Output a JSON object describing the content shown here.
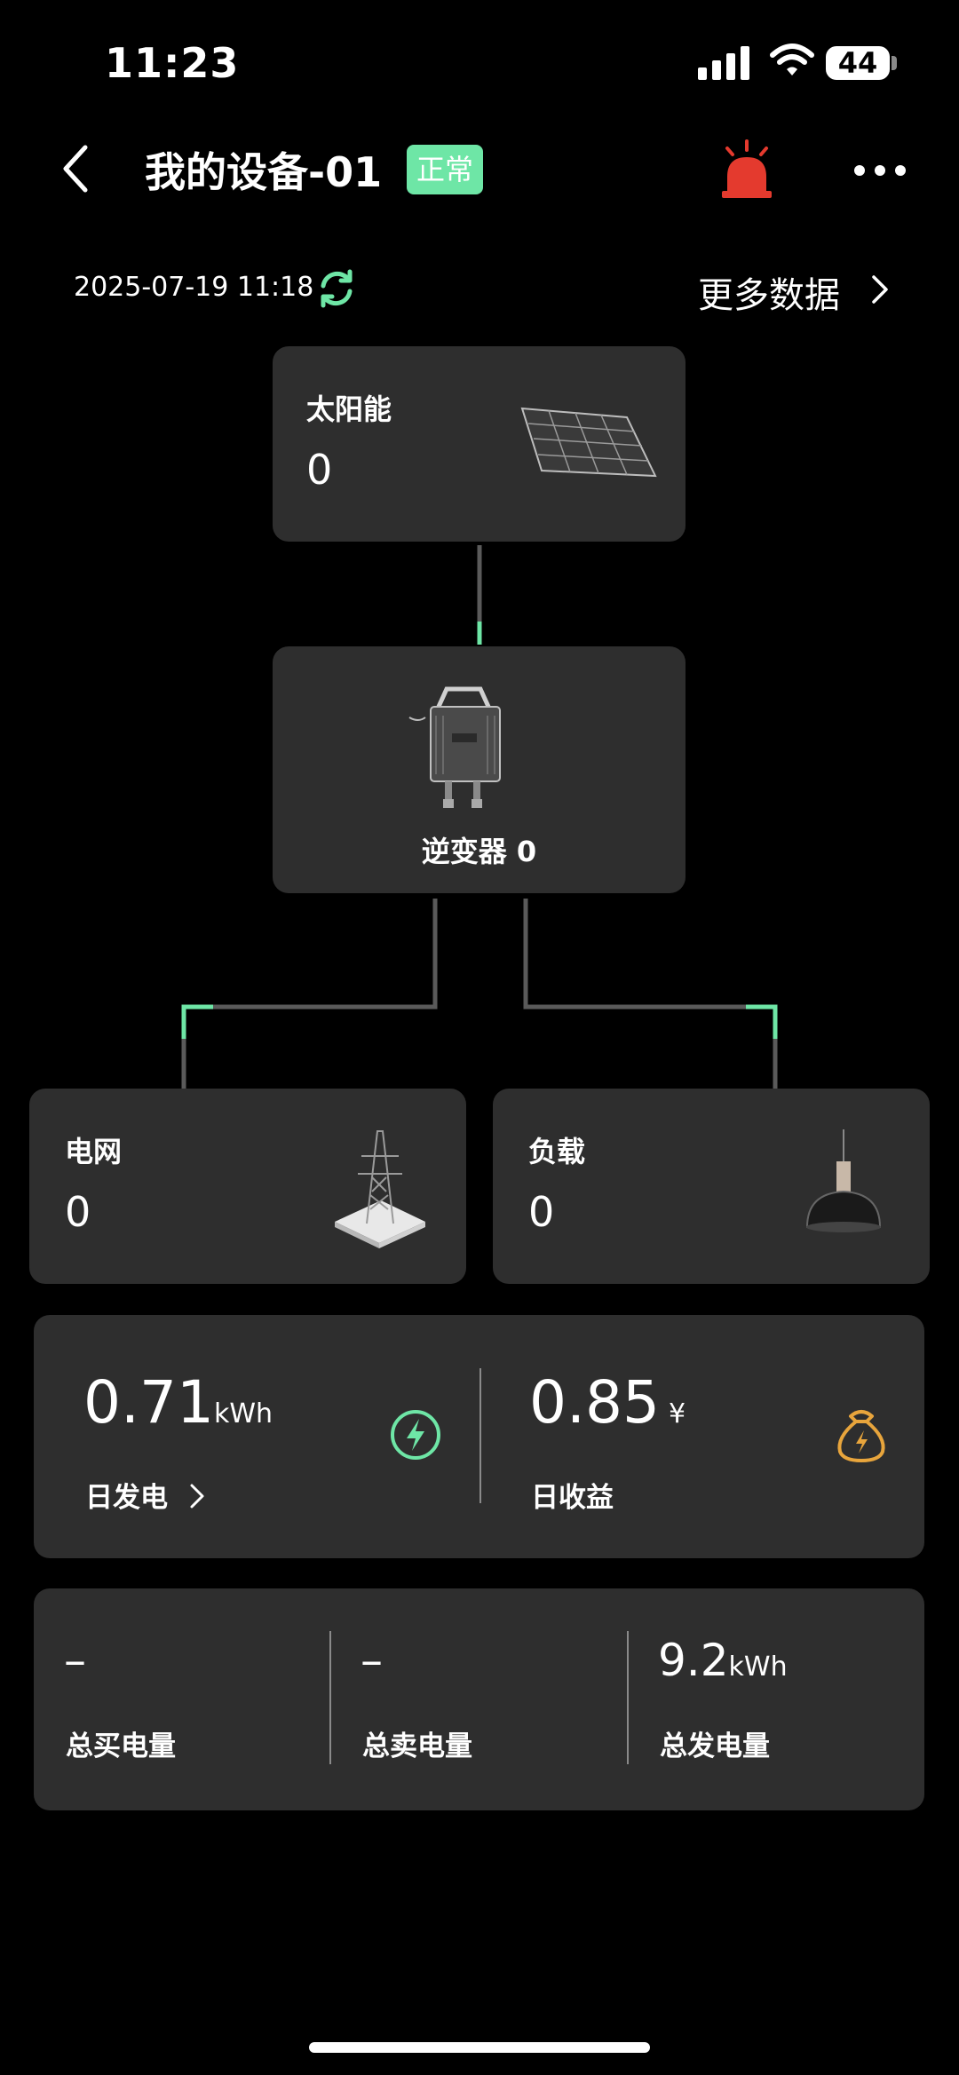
{
  "status_bar": {
    "time": "11:23",
    "battery": "44"
  },
  "header": {
    "title": "我的设备-01",
    "status": "正常"
  },
  "subheader": {
    "timestamp": "2025-07-19 11:18",
    "more_data": "更多数据"
  },
  "flow": {
    "solar": {
      "label": "太阳能",
      "value": "0"
    },
    "inverter": {
      "label": "逆变器 0"
    },
    "grid": {
      "label": "电网",
      "value": "0"
    },
    "load": {
      "label": "负载",
      "value": "0"
    }
  },
  "daily": {
    "generation": {
      "value": "0.71",
      "unit": "kWh",
      "label": "日发电"
    },
    "income": {
      "value": "0.85",
      "unit": "¥",
      "label": "日收益"
    }
  },
  "totals": [
    {
      "value": "–",
      "unit": "",
      "label": "总买电量"
    },
    {
      "value": "–",
      "unit": "",
      "label": "总卖电量"
    },
    {
      "value": "9.2",
      "unit": "kWh",
      "label": "总发电量"
    }
  ],
  "colors": {
    "accent_green": "#6ee6a6",
    "gold": "#e8a53c",
    "alarm_red": "#e43a2e",
    "card": "#2e2e2e"
  },
  "icons": [
    "back-icon",
    "alarm-icon",
    "more-icon",
    "refresh-icon",
    "chevron-right-icon",
    "solar-panel-icon",
    "inverter-icon",
    "power-tower-icon",
    "lamp-icon",
    "lightning-icon",
    "money-bag-icon"
  ]
}
